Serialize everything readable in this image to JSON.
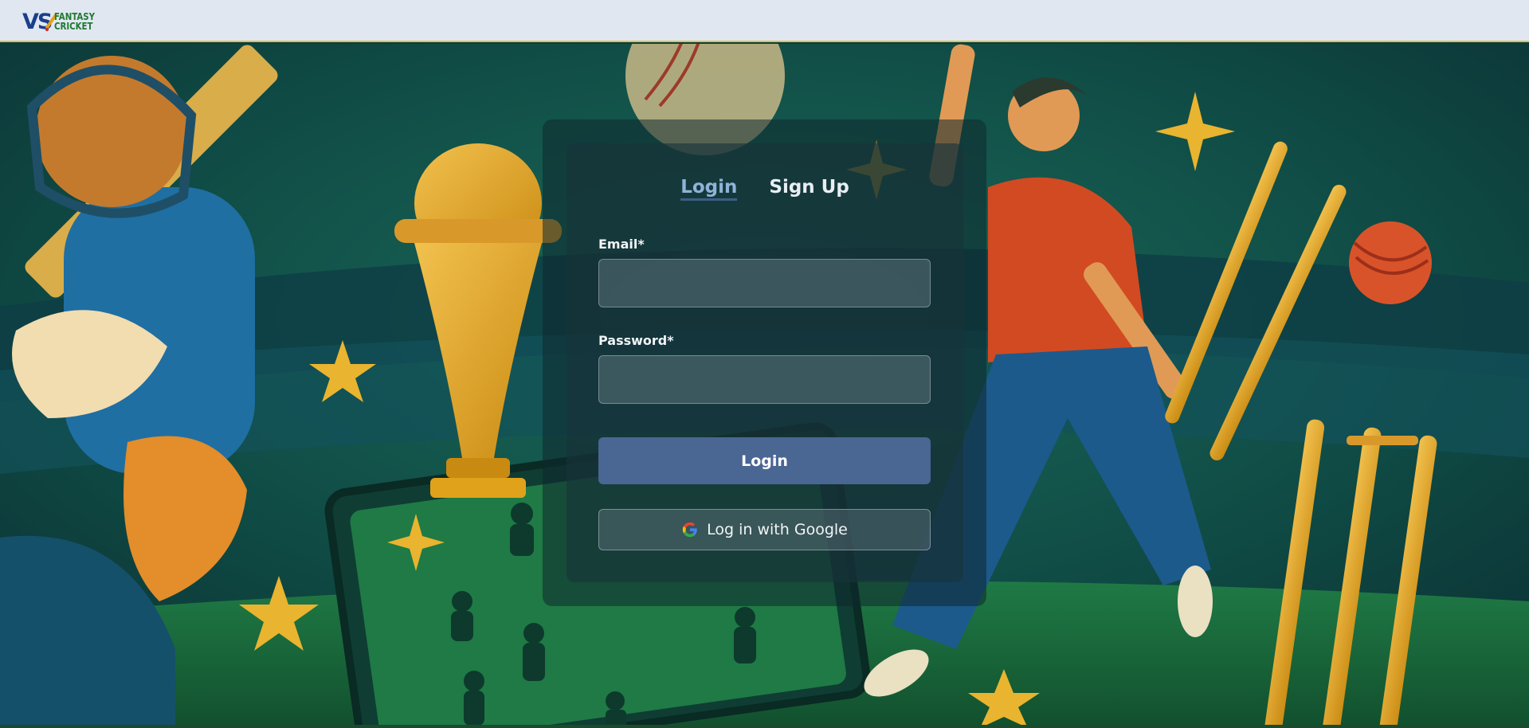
{
  "brand": {
    "logo_mark": "VS",
    "logo_line1": "FANTASY",
    "logo_line2": "CRICKET"
  },
  "auth": {
    "tabs": [
      {
        "label": "Login",
        "active": true
      },
      {
        "label": "Sign Up",
        "active": false
      }
    ],
    "email_label": "Email*",
    "email_value": "",
    "password_label": "Password*",
    "password_value": "",
    "login_button": "Login",
    "google_button": "Log in with Google"
  },
  "colors": {
    "topbar": "#e1e7f1",
    "accent_line": "#d9c54a",
    "primary_button": "#4a6693",
    "active_tab": "#8fb3d8",
    "background_green": "#0f4a3c"
  },
  "icons": {
    "google": "google-g-icon",
    "logo": "cricket-bat-icon"
  }
}
